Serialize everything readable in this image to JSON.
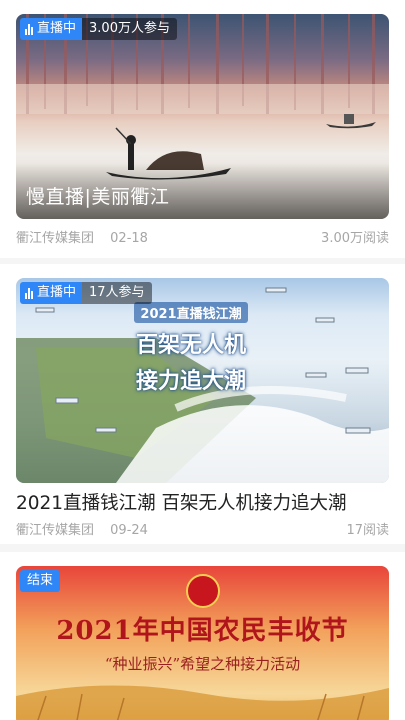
{
  "feed": {
    "items": [
      {
        "status": "直播中",
        "participants": "3.00万人参与",
        "overlay_title": "慢直播|美丽衢江",
        "source": "衢江传媒集团",
        "date": "02-18",
        "reads": "3.00万阅读"
      },
      {
        "status": "直播中",
        "participants": "17人参与",
        "overlay_heading": "2021直播钱江潮",
        "overlay_line1": "百架无人机",
        "overlay_line2": "接力追大潮",
        "title": "2021直播钱江潮 百架无人机接力追大潮",
        "source": "衢江传媒集团",
        "date": "09-24",
        "reads": "17阅读"
      },
      {
        "status": "结束",
        "banner_title": "2021年中国农民丰收节",
        "banner_subtitle": "“种业振兴”希望之种接力活动"
      }
    ]
  },
  "colors": {
    "live_badge": "#2f86f6",
    "meta_text": "#a6a6a6",
    "title_text": "#222222"
  },
  "icons": {
    "live": "live-signal-icon"
  }
}
